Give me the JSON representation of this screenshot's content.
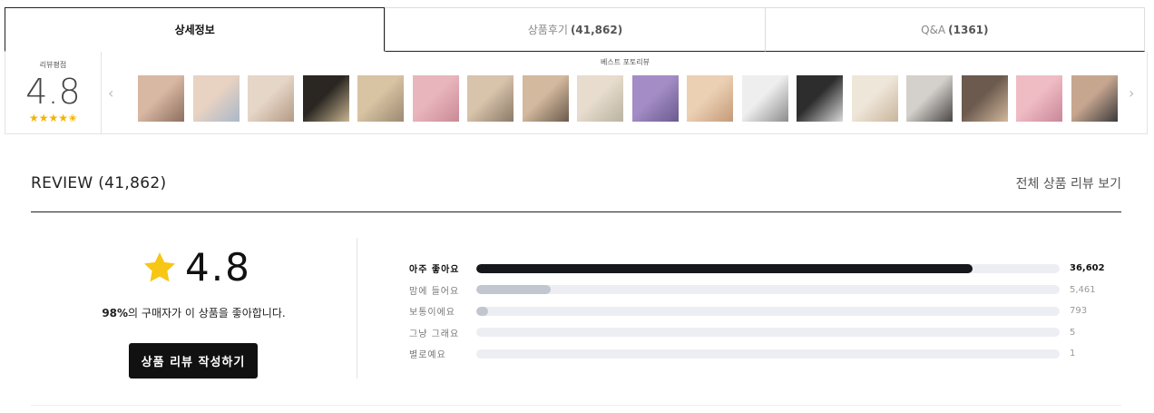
{
  "tabs": [
    {
      "label": "상세정보",
      "count": ""
    },
    {
      "label": "상품후기",
      "count": "(41,862)"
    },
    {
      "label": "Q&A",
      "count": "(1361)"
    }
  ],
  "strip": {
    "score_label": "리뷰평점",
    "score": "4.8",
    "stars": "★★★★✬",
    "best_label": "베스트 포토리뷰",
    "prev": "‹",
    "next": "›",
    "thumb_colors": [
      [
        "#d9b8a3",
        "#8d6f60"
      ],
      [
        "#e8d2c2",
        "#a9b8c9"
      ],
      [
        "#e6d6c8",
        "#b49a84"
      ],
      [
        "#2a2622",
        "#c8b591"
      ],
      [
        "#d8c3a2",
        "#9c8a72"
      ],
      [
        "#e9b5bd",
        "#c98a96"
      ],
      [
        "#d8c3ab",
        "#8b7a68"
      ],
      [
        "#d3b99d",
        "#6b5a4c"
      ],
      [
        "#e7dccd",
        "#b9b3a0"
      ],
      [
        "#a48dc6",
        "#6a5a8f"
      ],
      [
        "#ecd0b4",
        "#c49a78"
      ],
      [
        "#eeeeee",
        "#8c8c8c"
      ],
      [
        "#2d2d2d",
        "#d9d9d9"
      ],
      [
        "#efe6da",
        "#c9b59b"
      ],
      [
        "#d4d0cc",
        "#4a4644"
      ],
      [
        "#6c5a4e",
        "#d2b89b"
      ],
      [
        "#efbcc4",
        "#c98798"
      ],
      [
        "#c7a68f",
        "#3c3a3c"
      ]
    ]
  },
  "review": {
    "title": "REVIEW (41,862)",
    "view_all": "전체 상품 리뷰 보기",
    "score": "4.8",
    "like_pct": "98%",
    "like_rest": "의 구매자가 이 상품을 좋아합니다.",
    "write_btn": "상품 리뷰 작성하기",
    "rows": [
      {
        "label": "아주 좋아요",
        "count": "36,602",
        "value": 36602
      },
      {
        "label": "맘에 들어요",
        "count": "5,461",
        "value": 5461
      },
      {
        "label": "보통이에요",
        "count": "793",
        "value": 793
      },
      {
        "label": "그냥 그래요",
        "count": "5",
        "value": 5
      },
      {
        "label": "별로예요",
        "count": "1",
        "value": 1
      }
    ]
  },
  "colors": {
    "star": "#f8c614",
    "bar_top": "#15171c",
    "bar_other": "#c2c6cf",
    "track": "#eceef4"
  }
}
